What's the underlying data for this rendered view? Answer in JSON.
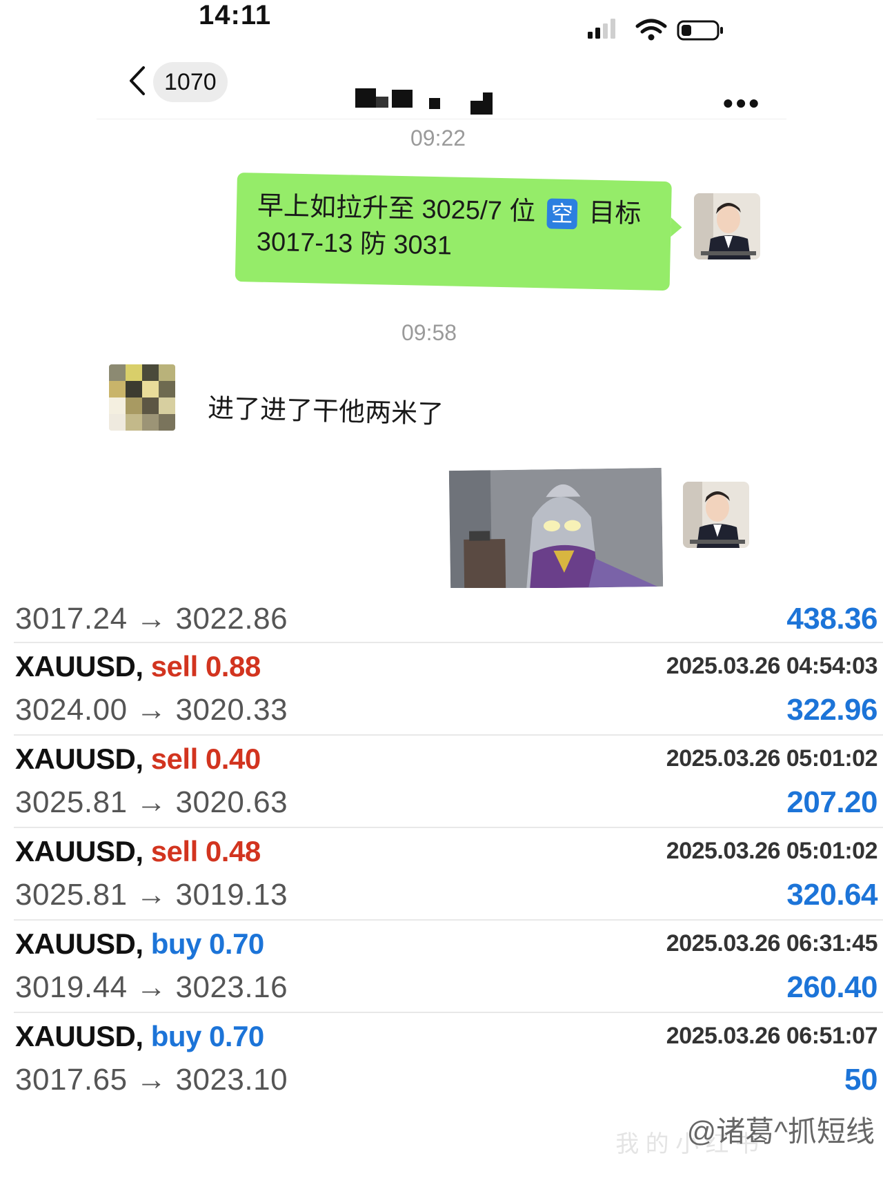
{
  "status_bar": {
    "time": "14:11"
  },
  "nav": {
    "back_count": "1070",
    "more": "•••"
  },
  "chat": {
    "timestamps": [
      "09:22",
      "09:58"
    ],
    "outgoing_text_line1_a": "早上如拉升至 3025/7 位",
    "outgoing_badge": "空",
    "outgoing_text_line1_b": "目标",
    "outgoing_text_line2": "3017-13 防 3031",
    "incoming_text": "进了进了干他两米了"
  },
  "trades": {
    "first_prices": "3017.24 → 3022.86",
    "first_profit": "438.36",
    "rows": [
      {
        "symbol": "XAUUSD,",
        "side": "sell 0.88",
        "time": "2025.03.26 04:54:03",
        "prices": "3024.00 → 3020.33",
        "profit": "322.96"
      },
      {
        "symbol": "XAUUSD,",
        "side": "sell 0.40",
        "time": "2025.03.26 05:01:02",
        "prices": "3025.81 → 3020.63",
        "profit": "207.20"
      },
      {
        "symbol": "XAUUSD,",
        "side": "sell 0.48",
        "time": "2025.03.26 05:01:02",
        "prices": "3025.81 → 3019.13",
        "profit": "320.64"
      },
      {
        "symbol": "XAUUSD,",
        "side": "buy 0.70",
        "time": "2025.03.26 06:31:45",
        "prices": "3019.44 → 3023.16",
        "profit": "260.40"
      },
      {
        "symbol": "XAUUSD,",
        "side": "buy 0.70",
        "time": "2025.03.26 06:51:07",
        "prices": "3017.65 → 3023.10",
        "profit": "50"
      }
    ]
  },
  "watermark": "@诸葛^抓短线",
  "colors": {
    "bubble_green": "#95ec69",
    "sell_red": "#d2341f",
    "buy_blue": "#1c74d8",
    "badge_blue": "#2c7fe0"
  },
  "icons": [
    "signal-icon",
    "wifi-icon",
    "battery-icon",
    "back-chevron-icon"
  ]
}
